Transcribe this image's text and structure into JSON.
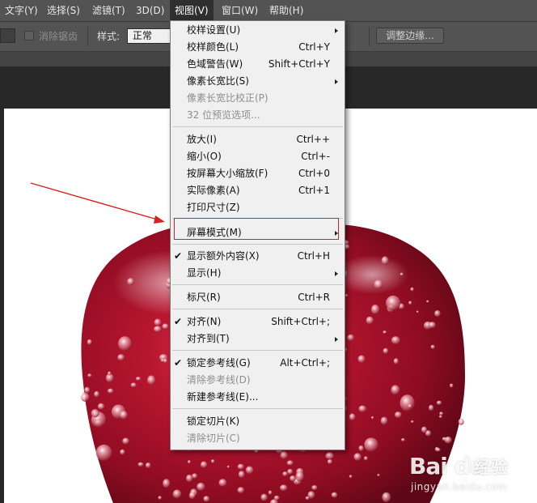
{
  "menubar": {
    "items": [
      {
        "label": "文字(Y)"
      },
      {
        "label": "选择(S)"
      },
      {
        "label": "滤镜(T)"
      },
      {
        "label": "3D(D)"
      },
      {
        "label": "视图(V)",
        "active": true
      },
      {
        "label": "窗口(W)"
      },
      {
        "label": "帮助(H)"
      }
    ]
  },
  "options_bar": {
    "anti_alias_label": "消除锯齿",
    "style_label": "样式:",
    "style_value": "正常",
    "refine_edge_button": "调整边缘..."
  },
  "view_menu": {
    "items": [
      {
        "label": "校样设置(U)",
        "shortcut": "",
        "submenu": true,
        "disabled": false,
        "checked": false
      },
      {
        "label": "校样颜色(L)",
        "shortcut": "Ctrl+Y",
        "submenu": false,
        "disabled": false,
        "checked": false
      },
      {
        "label": "色域警告(W)",
        "shortcut": "Shift+Ctrl+Y",
        "submenu": false,
        "disabled": false,
        "checked": false
      },
      {
        "label": "像素长宽比(S)",
        "shortcut": "",
        "submenu": true,
        "disabled": false,
        "checked": false
      },
      {
        "label": "像素长宽比校正(P)",
        "shortcut": "",
        "submenu": false,
        "disabled": true,
        "checked": false
      },
      {
        "label": "32 位预览选项...",
        "shortcut": "",
        "submenu": false,
        "disabled": true,
        "checked": false
      },
      {
        "separator": true
      },
      {
        "label": "放大(I)",
        "shortcut": "Ctrl++",
        "submenu": false,
        "disabled": false,
        "checked": false
      },
      {
        "label": "缩小(O)",
        "shortcut": "Ctrl+-",
        "submenu": false,
        "disabled": false,
        "checked": false
      },
      {
        "label": "按屏幕大小缩放(F)",
        "shortcut": "Ctrl+0",
        "submenu": false,
        "disabled": false,
        "checked": false
      },
      {
        "label": "实际像素(A)",
        "shortcut": "Ctrl+1",
        "submenu": false,
        "disabled": false,
        "checked": false
      },
      {
        "label": "打印尺寸(Z)",
        "shortcut": "",
        "submenu": false,
        "disabled": false,
        "checked": false
      },
      {
        "separator": true
      },
      {
        "label": "屏幕模式(M)",
        "shortcut": "",
        "submenu": true,
        "disabled": false,
        "checked": false,
        "highlighted": true
      },
      {
        "separator": true
      },
      {
        "label": "显示额外内容(X)",
        "shortcut": "Ctrl+H",
        "submenu": false,
        "disabled": false,
        "checked": true
      },
      {
        "label": "显示(H)",
        "shortcut": "",
        "submenu": true,
        "disabled": false,
        "checked": false
      },
      {
        "separator": true
      },
      {
        "label": "标尺(R)",
        "shortcut": "Ctrl+R",
        "submenu": false,
        "disabled": false,
        "checked": false
      },
      {
        "separator": true
      },
      {
        "label": "对齐(N)",
        "shortcut": "Shift+Ctrl+;",
        "submenu": false,
        "disabled": false,
        "checked": true
      },
      {
        "label": "对齐到(T)",
        "shortcut": "",
        "submenu": true,
        "disabled": false,
        "checked": false
      },
      {
        "separator": true
      },
      {
        "label": "锁定参考线(G)",
        "shortcut": "Alt+Ctrl+;",
        "submenu": false,
        "disabled": false,
        "checked": true
      },
      {
        "label": "清除参考线(D)",
        "shortcut": "",
        "submenu": false,
        "disabled": true,
        "checked": false
      },
      {
        "label": "新建参考线(E)...",
        "shortcut": "",
        "submenu": false,
        "disabled": false,
        "checked": false
      },
      {
        "separator": true
      },
      {
        "label": "锁定切片(K)",
        "shortcut": "",
        "submenu": false,
        "disabled": false,
        "checked": false
      },
      {
        "label": "清除切片(C)",
        "shortcut": "",
        "submenu": false,
        "disabled": true,
        "checked": false
      }
    ]
  },
  "colors": {
    "annotation_red": "#d82020",
    "apple_red": "#b0142a",
    "menubar_bg": "#535353"
  },
  "watermark": {
    "logo": "Bai du",
    "text": "经验",
    "url": "jingyan.baidu.com"
  }
}
